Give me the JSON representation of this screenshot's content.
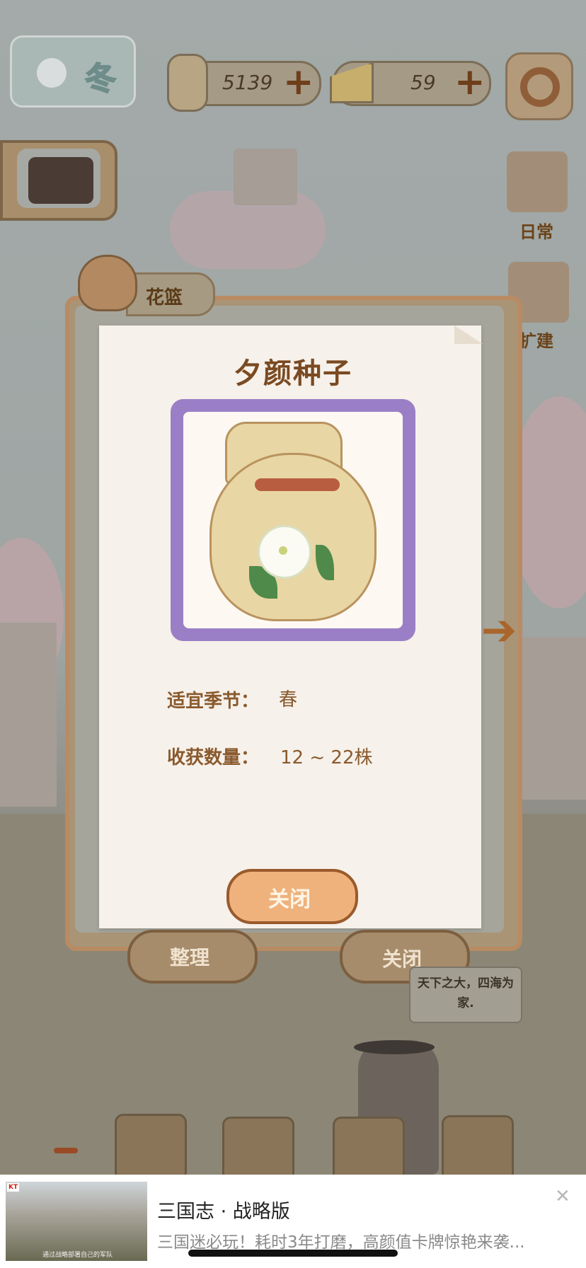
{
  "topbar": {
    "season": "冬",
    "fish_count": "5139",
    "cheese_count": "59",
    "plus": "+"
  },
  "side_menu": {
    "daily_label": "日常",
    "expand_label": "扩建"
  },
  "panel": {
    "tab_label": "花篮",
    "item_title": "夕颜种子",
    "season_label": "适宜季节：",
    "season_value": "春",
    "harvest_label": "收获数量：",
    "harvest_value": "12 ~ 22株",
    "close_button": "关闭"
  },
  "bottom_buttons": {
    "organize": "整理",
    "close": "关闭"
  },
  "speech_bubble": "天下之大，四海为家.",
  "ad": {
    "badge": "KT",
    "title": "三国志 · 战略版",
    "description": "三国迷必玩！耗时3年打磨，高颜值卡牌惊艳来袭...",
    "thumb_caption": "通过战略部署自己的军队",
    "close": "✕"
  },
  "colors": {
    "frame_purple": "#9a7fc7",
    "title_brown": "#7a4a22",
    "button_orange": "#efb27d"
  }
}
